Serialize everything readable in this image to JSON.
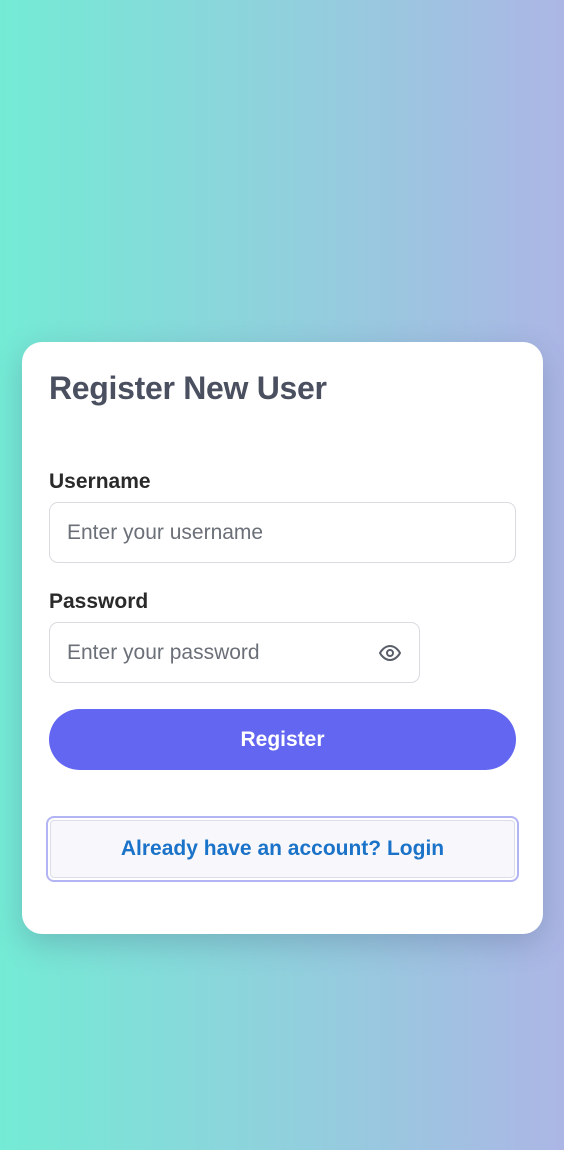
{
  "form": {
    "title": "Register New User",
    "username": {
      "label": "Username",
      "placeholder": "Enter your username",
      "value": ""
    },
    "password": {
      "label": "Password",
      "placeholder": "Enter your password",
      "value": "",
      "toggle_icon": "eye-icon"
    },
    "register_label": "Register",
    "login_label": "Already have an account? Login"
  },
  "colors": {
    "background_gradient_start": "#74ebd5",
    "background_gradient_end": "#acb6e5",
    "primary_button": "#6366f1",
    "link_text": "#1a73c8",
    "title_text": "#4b5060"
  }
}
